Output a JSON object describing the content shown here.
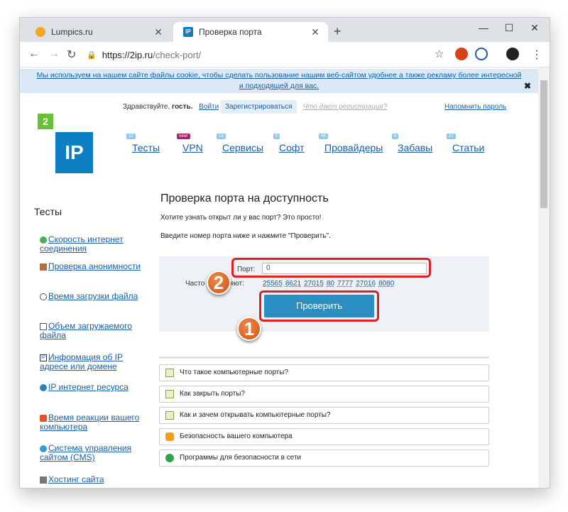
{
  "tabs": [
    {
      "label": "Lumpics.ru"
    },
    {
      "label": "Проверка порта"
    }
  ],
  "url": {
    "host": "https://2ip.ru",
    "path": "/check-port/"
  },
  "cookie": {
    "text": "Мы используем на нашем сайте файлы cookie, чтобы сделать пользование нашим веб-сайтом удобнее а также рекламу более интересной и подходящей для вас."
  },
  "login": {
    "greeting": "Здравствуйте,",
    "guest": "гость.",
    "enter": "Войти",
    "register": "Зарегистрироваться",
    "why": "Что дает регистрация?",
    "remind": "Напомнить пароль"
  },
  "logo": {
    "small": "2",
    "main": "IP"
  },
  "menu": [
    {
      "label": "Тесты",
      "badge": "32"
    },
    {
      "label": "VPN",
      "badge": "new!"
    },
    {
      "label": "Сервисы",
      "badge": "18"
    },
    {
      "label": "Софт",
      "badge": "6"
    },
    {
      "label": "Провайдеры",
      "badge": "4K"
    },
    {
      "label": "Забавы",
      "badge": "6"
    },
    {
      "label": "Статьи",
      "badge": "37"
    }
  ],
  "sidebar": {
    "title": "Тесты",
    "items": [
      {
        "label": "Скорость интернет соединения"
      },
      {
        "label": "Проверка анонимности"
      },
      {
        "label": "Время загрузки файла"
      },
      {
        "label": "Объем загружаемого файла"
      },
      {
        "label": "Информация об IP адресе или домене"
      },
      {
        "label": "IP интернет ресурса"
      },
      {
        "label": "Время реакции вашего компьютера"
      },
      {
        "label": "Система управления сайтом (CMS)"
      },
      {
        "label": "Хостинг сайта"
      }
    ]
  },
  "main": {
    "title": "Проверка порта на доступность",
    "intro": "Хотите узнать открыт ли у вас порт? Это просто!",
    "instr": "Введите номер порта ниже и нажмите \"Проверить\".",
    "port_label": "Порт:",
    "port_value": "0",
    "often_label": "Часто проверяют:",
    "ports": [
      "25565",
      "8621",
      "27015",
      "80",
      "7777",
      "27016",
      "8080"
    ],
    "check_button": "Проверить",
    "markers": [
      "2",
      "1"
    ]
  },
  "faq": [
    {
      "label": "Что такое компьютерные порты?"
    },
    {
      "label": "Как закрыть порты?"
    },
    {
      "label": "Как и зачем открывать компьютерные порты?"
    },
    {
      "label": "Безопасность вашего компьютера"
    },
    {
      "label": "Программы для безопасности в сети"
    }
  ]
}
